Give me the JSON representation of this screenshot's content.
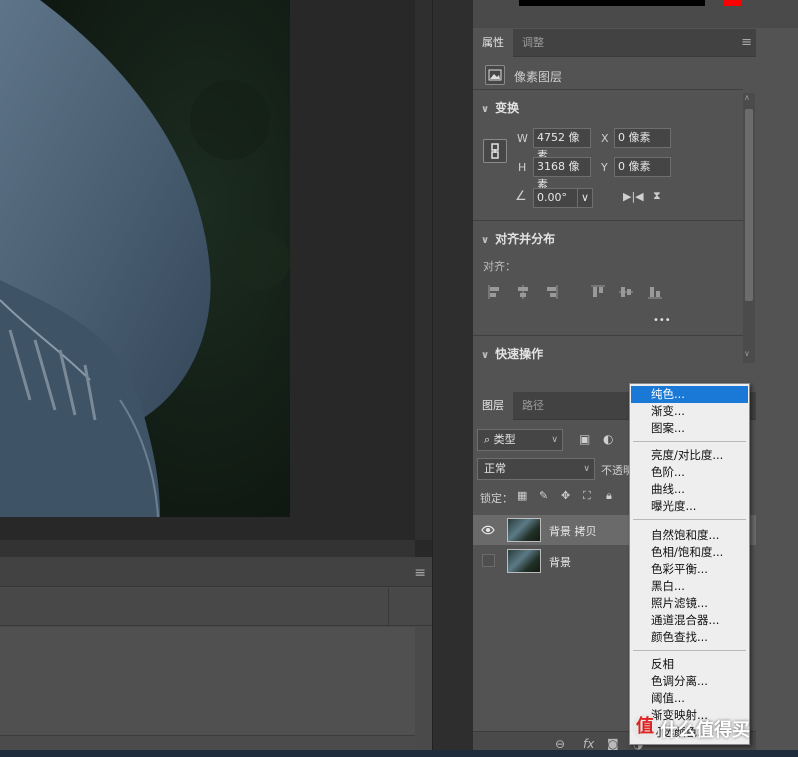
{
  "properties_panel": {
    "tabs": [
      {
        "label": "属性",
        "active": true
      },
      {
        "label": "调整",
        "active": false
      }
    ],
    "layer_kind": "像素图层",
    "transform": {
      "title": "变换",
      "w_label": "W",
      "w_value": "4752 像素",
      "x_label": "X",
      "x_value": "0 像素",
      "h_label": "H",
      "h_value": "3168 像素",
      "y_label": "Y",
      "y_value": "0 像素",
      "angle_value": "0.00°"
    },
    "align": {
      "title": "对齐并分布",
      "align_label": "对齐：",
      "more": "•••"
    },
    "quick_actions": {
      "title": "快速操作"
    }
  },
  "layers_panel": {
    "tabs": [
      {
        "label": "图层",
        "active": true
      },
      {
        "label": "路径",
        "active": false
      }
    ],
    "filter_kind": "类型",
    "blend_mode": "正常",
    "opacity_label": "不透明",
    "lock_label": "锁定：",
    "layers": [
      {
        "name": "背景 拷贝",
        "visible": true,
        "selected": true
      },
      {
        "name": "背景",
        "visible": false,
        "selected": false
      }
    ],
    "footer_fx": "fx"
  },
  "adjustment_menu": {
    "groups": [
      [
        {
          "label": "纯色...",
          "highlighted": true
        },
        {
          "label": "渐变...",
          "highlighted": false
        },
        {
          "label": "图案...",
          "highlighted": false
        }
      ],
      [
        {
          "label": "亮度/对比度...",
          "highlighted": false
        },
        {
          "label": "色阶...",
          "highlighted": false
        },
        {
          "label": "曲线...",
          "highlighted": false
        },
        {
          "label": "曝光度...",
          "highlighted": false
        }
      ],
      [
        {
          "label": "自然饱和度...",
          "highlighted": false
        },
        {
          "label": "色相/饱和度...",
          "highlighted": false
        },
        {
          "label": "色彩平衡...",
          "highlighted": false
        },
        {
          "label": "黑白...",
          "highlighted": false
        },
        {
          "label": "照片滤镜...",
          "highlighted": false
        },
        {
          "label": "通道混合器...",
          "highlighted": false
        },
        {
          "label": "颜色查找...",
          "highlighted": false
        }
      ],
      [
        {
          "label": "反相",
          "highlighted": false
        },
        {
          "label": "色调分离...",
          "highlighted": false
        },
        {
          "label": "阈值...",
          "highlighted": false
        },
        {
          "label": "渐变映射...",
          "highlighted": false
        },
        {
          "label": "可选颜色...",
          "highlighted": false
        }
      ]
    ]
  },
  "watermark": {
    "logo": "值",
    "text": "什么值得买"
  },
  "colors": {
    "accent": "#1a78d6",
    "foreground_swatch": "#000000",
    "alert_swatch": "#ff0000",
    "panel_bg": "#535353"
  }
}
